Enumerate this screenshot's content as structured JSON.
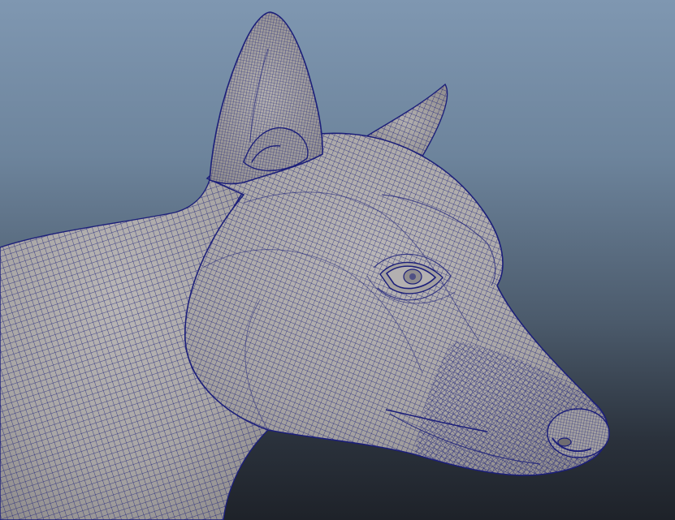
{
  "viewport": {
    "background_top": "#7f97b1",
    "background_bottom": "#1e2229",
    "mesh_surface_color": "#a9a6a6",
    "wireframe_color": "#1c1f7a"
  }
}
